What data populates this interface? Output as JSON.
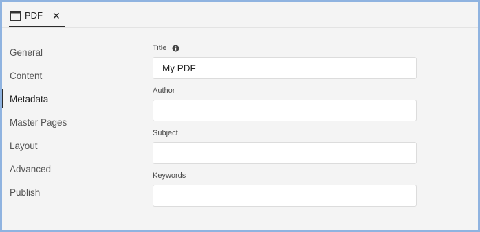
{
  "tab": {
    "label": "PDF",
    "close_symbol": "✕",
    "icon": "document-window-icon"
  },
  "sidebar": {
    "items": [
      {
        "label": "General"
      },
      {
        "label": "Content"
      },
      {
        "label": "Metadata",
        "active": true
      },
      {
        "label": "Master Pages"
      },
      {
        "label": "Layout"
      },
      {
        "label": "Advanced"
      },
      {
        "label": "Publish"
      }
    ]
  },
  "form": {
    "title": {
      "label": "Title",
      "value": "My PDF",
      "info_icon": "info-icon"
    },
    "author": {
      "label": "Author",
      "value": ""
    },
    "subject": {
      "label": "Subject",
      "value": ""
    },
    "keywords": {
      "label": "Keywords",
      "value": ""
    }
  },
  "colors": {
    "accent": "#2c2c2c",
    "window_border": "#8fb3e0",
    "panel_bg": "#f4f4f4"
  }
}
